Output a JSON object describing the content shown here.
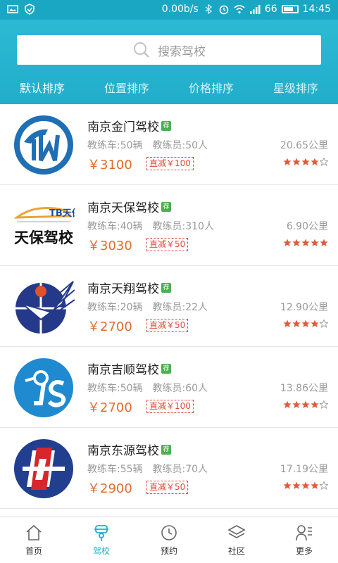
{
  "status_bar": {
    "speed": "0.00b/s",
    "battery": "66",
    "time": "14:45",
    "icons": [
      "image-icon",
      "shield-icon",
      "bluetooth-icon",
      "alarm-icon",
      "wifi-icon",
      "signal-icon",
      "battery-icon"
    ]
  },
  "search": {
    "placeholder": "搜索驾校",
    "icon": "search-icon"
  },
  "sort_tabs": [
    {
      "label": "默认排序",
      "active": true
    },
    {
      "label": "位置排序",
      "active": false
    },
    {
      "label": "价格排序",
      "active": false
    },
    {
      "label": "星级排序",
      "active": false
    }
  ],
  "schools": [
    {
      "name": "南京金门驾校",
      "tag": "荐",
      "cars": "教练车:50辆",
      "coaches": "教练员:50人",
      "distance": "20.65公里",
      "price": "￥3100",
      "discount": "直减￥100",
      "rating": 4,
      "logo": "jinmen-logo"
    },
    {
      "name": "南京天保驾校",
      "tag": "荐",
      "cars": "教练车:40辆",
      "coaches": "教练员:310人",
      "distance": "6.90公里",
      "price": "￥3030",
      "discount": "直减￥50",
      "rating": 5,
      "logo": "tianbao-logo",
      "logo_text_top": "TB天保",
      "logo_text_main": "天保驾校"
    },
    {
      "name": "南京天翔驾校",
      "tag": "荐",
      "cars": "教练车:20辆",
      "coaches": "教练员:22人",
      "distance": "12.90公里",
      "price": "￥2700",
      "discount": "直减￥50",
      "rating": 4,
      "logo": "tianxiang-logo"
    },
    {
      "name": "南京吉顺驾校",
      "tag": "荐",
      "cars": "教练车:50辆",
      "coaches": "教练员:60人",
      "distance": "13.86公里",
      "price": "￥2700",
      "discount": "直减￥100",
      "rating": 4,
      "logo": "jishun-logo"
    },
    {
      "name": "南京东源驾校",
      "tag": "荐",
      "cars": "教练车:55辆",
      "coaches": "教练员:70人",
      "distance": "17.19公里",
      "price": "￥2900",
      "discount": "直减￥50",
      "rating": 4,
      "logo": "dongyuan-logo"
    }
  ],
  "bottom_nav": [
    {
      "label": "首页",
      "icon": "home-icon",
      "active": false
    },
    {
      "label": "驾校",
      "icon": "driving-school-icon",
      "active": true
    },
    {
      "label": "预约",
      "icon": "clock-icon",
      "active": false
    },
    {
      "label": "社区",
      "icon": "layers-icon",
      "active": false
    },
    {
      "label": "更多",
      "icon": "profile-list-icon",
      "active": false
    }
  ],
  "colors": {
    "primary": "#22aecb",
    "price": "#e36b2c",
    "discount": "#e04a3a",
    "star": "#e05a3a",
    "tag": "#4caf50"
  }
}
